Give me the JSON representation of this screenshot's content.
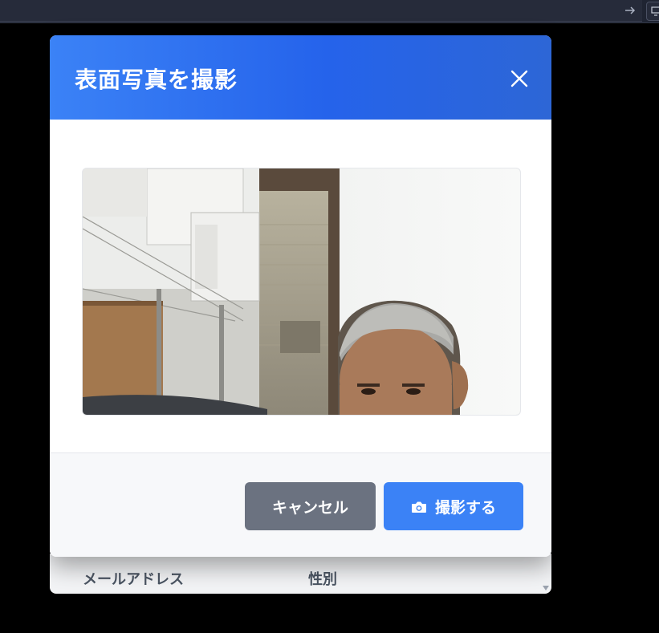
{
  "modal": {
    "title": "表面写真を撮影",
    "cancel_label": "キャンセル",
    "capture_label": "撮影する"
  },
  "background_table": {
    "columns": [
      "メールアドレス",
      "性別"
    ]
  },
  "colors": {
    "header_start": "#3b82f6",
    "header_end": "#2563eb",
    "cancel_button": "#6b7280",
    "capture_button": "#3b82f6"
  },
  "icons": {
    "close": "close-icon",
    "camera": "camera-icon",
    "arrow": "arrow-right-icon",
    "screen": "monitor-icon"
  }
}
